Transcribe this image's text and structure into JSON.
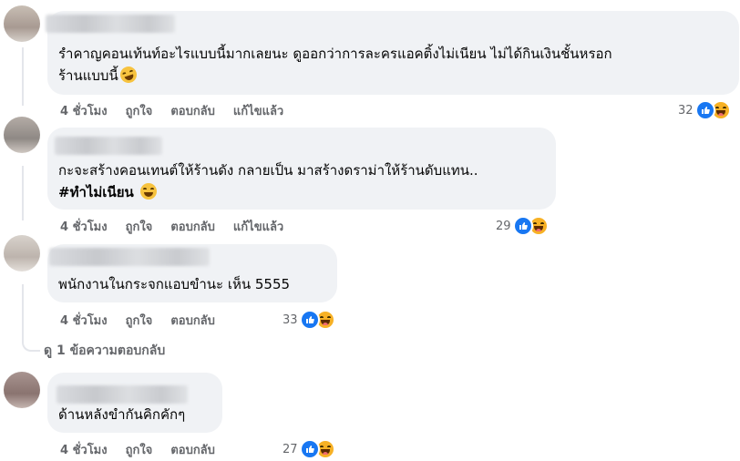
{
  "comments": [
    {
      "text_lines": [
        "รำคาญคอนเท้นท์อะไรแบบนี้มากเลยนะ ดูออกว่าการละครแอคติ้งไม่เนียน ไม่ได้กินเงินชั้นหรอก",
        "ร้านแบบนี้"
      ],
      "emoji": "rofl-emoji",
      "time": "4 ชั่วโมง",
      "like": "ถูกใจ",
      "reply": "ตอบกลับ",
      "edited": "แก้ไขแล้ว",
      "reaction_count": "32",
      "reactions": [
        "like-icon",
        "haha-icon"
      ]
    },
    {
      "text_lines": [
        "กะจะสร้างคอนเทนต์ให้ร้านดัง กลายเป็น มาสร้างดราม่าให้ร้านดับแทน.."
      ],
      "hashtag": "#ทำไม่เนียน",
      "emoji": "grin-emoji",
      "time": "4 ชั่วโมง",
      "like": "ถูกใจ",
      "reply": "ตอบกลับ",
      "edited": "แก้ไขแล้ว",
      "reaction_count": "29",
      "reactions": [
        "like-icon",
        "haha-icon"
      ]
    },
    {
      "text_lines": [
        "พนักงานในกระจกแอบขำนะ เห็น 5555"
      ],
      "time": "4 ชั่วโมง",
      "like": "ถูกใจ",
      "reply": "ตอบกลับ",
      "reaction_count": "33",
      "reactions": [
        "like-icon",
        "haha-icon"
      ]
    },
    {
      "text_lines": [
        "ด้านหลังขำกันคิกคักๆ"
      ],
      "time": "4 ชั่วโมง",
      "like": "ถูกใจ",
      "reply": "ตอบกลับ",
      "reaction_count": "27",
      "reactions": [
        "like-icon",
        "haha-icon"
      ]
    }
  ],
  "view_replies": "ดู 1 ข้อความตอบกลับ",
  "colors": {
    "bubble": "#f0f2f5",
    "meta_text": "#65676b",
    "like_blue": "#1877f2",
    "haha_yellow": "#f7b125"
  }
}
